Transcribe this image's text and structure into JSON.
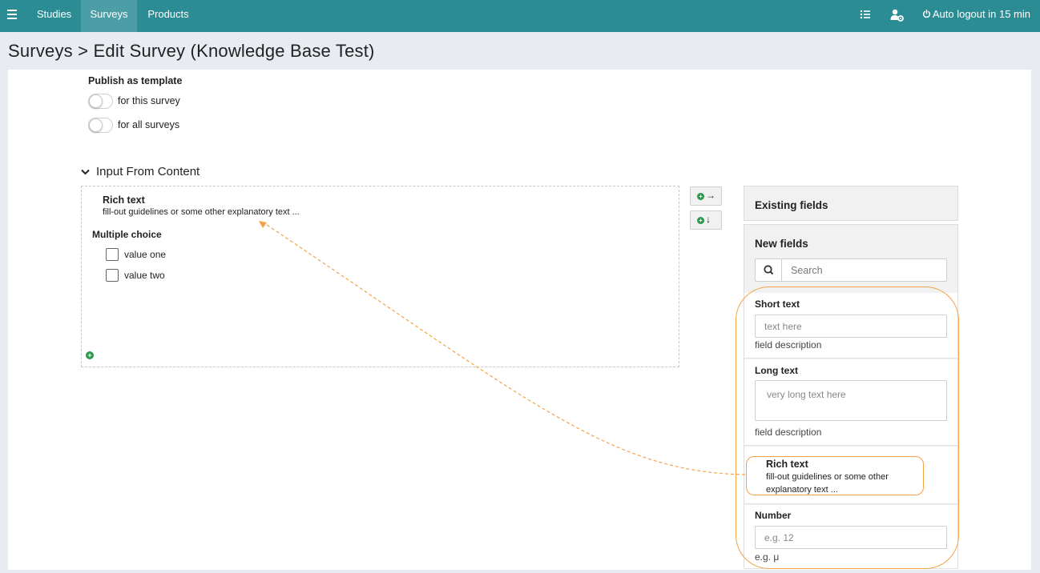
{
  "topnav": {
    "tabs": [
      {
        "label": "Studies"
      },
      {
        "label": "Surveys"
      },
      {
        "label": "Products"
      }
    ],
    "autologout": "Auto logout in 15 min",
    "icons": [
      "menu-icon",
      "list-icon",
      "user-settings-icon",
      "power-icon"
    ],
    "color": "#2c8c94"
  },
  "breadcrumb": {
    "title": "Surveys > Edit Survey (Knowledge Base Test)"
  },
  "publish": {
    "label": "Publish as template",
    "options": [
      {
        "label": "for this survey",
        "on": false
      },
      {
        "label": "for all surveys",
        "on": false
      }
    ]
  },
  "section": {
    "title": "Input From Content",
    "rich_text": {
      "title": "Rich text",
      "desc": "fill-out guidelines or some other explanatory text ..."
    },
    "multiple_choice": {
      "title": "Multiple choice",
      "options": [
        "value one",
        "value two"
      ]
    }
  },
  "sidebar": {
    "existing": "Existing fields",
    "new": "New fields",
    "search_placeholder": "Search",
    "short_text": {
      "label": "Short text",
      "placeholder": "text here",
      "desc": "field description"
    },
    "long_text": {
      "label": "Long text",
      "placeholder": "very long text here",
      "desc": "field description"
    },
    "rich_text": {
      "label": "Rich text",
      "desc": "fill-out guidelines or some other explanatory text ..."
    },
    "number": {
      "label": "Number",
      "placeholder": "e.g. 12",
      "desc": "e.g. μ"
    }
  },
  "colors": {
    "accent": "#2c8c94",
    "annotation": "#f4a24a",
    "add_green": "#2a9a4a"
  }
}
